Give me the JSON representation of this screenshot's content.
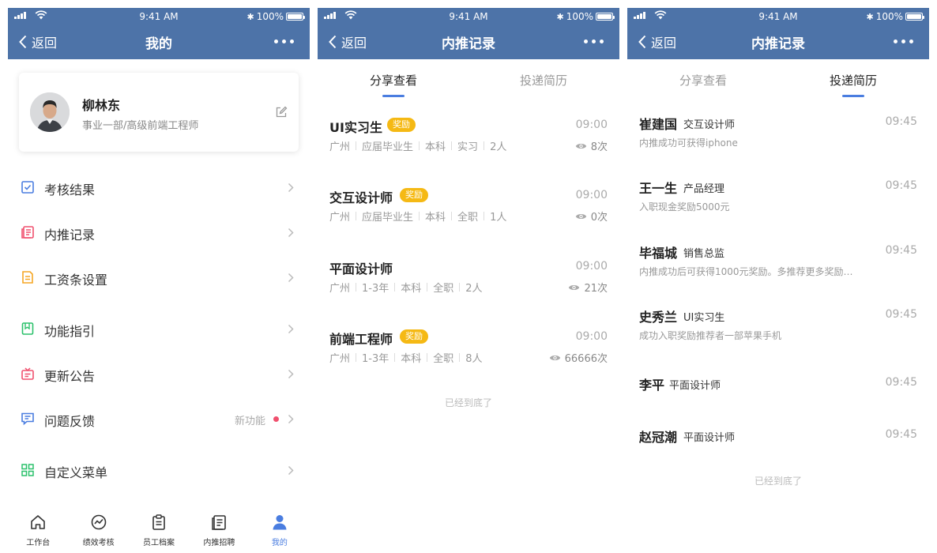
{
  "status": {
    "time": "9:41 AM",
    "battery": "100%"
  },
  "screens": {
    "mine": {
      "back_label": "返回",
      "title": "我的",
      "profile": {
        "name": "柳林东",
        "role": "事业一部/高级前端工程师"
      },
      "menu": [
        {
          "label": "考核结果",
          "icon": "checklist-icon",
          "color": "#4a7de0"
        },
        {
          "label": "内推记录",
          "icon": "record-icon",
          "color": "#f0506e"
        },
        {
          "label": "工资条设置",
          "icon": "payslip-icon",
          "color": "#f5a623"
        },
        {
          "label": "功能指引",
          "icon": "bookmark-icon",
          "color": "#2bc16b"
        },
        {
          "label": "更新公告",
          "icon": "announcement-icon",
          "color": "#f0506e"
        },
        {
          "label": "问题反馈",
          "icon": "feedback-icon",
          "color": "#4a7de0",
          "badge": "新功能"
        },
        {
          "label": "自定义菜单",
          "icon": "grid-icon",
          "color": "#2bc16b"
        }
      ],
      "tabbar": [
        {
          "label": "工作台",
          "icon": "home-icon"
        },
        {
          "label": "绩效考核",
          "icon": "performance-icon"
        },
        {
          "label": "员工档案",
          "icon": "clipboard-icon"
        },
        {
          "label": "内推招聘",
          "icon": "document-icon"
        },
        {
          "label": "我的",
          "icon": "user-icon",
          "active": true
        }
      ]
    },
    "share": {
      "back_label": "返回",
      "title": "内推记录",
      "tabs": [
        "分享查看",
        "投递简历"
      ],
      "jobs": [
        {
          "title": "UI实习生",
          "badge": "奖励",
          "time": "09:00",
          "tags": [
            "广州",
            "应届毕业生",
            "本科",
            "实习",
            "2人"
          ],
          "views": "8次"
        },
        {
          "title": "交互设计师",
          "badge": "奖励",
          "time": "09:00",
          "tags": [
            "广州",
            "应届毕业生",
            "本科",
            "全职",
            "1人"
          ],
          "views": "0次"
        },
        {
          "title": "平面设计师",
          "badge": "",
          "time": "09:00",
          "tags": [
            "广州",
            "1-3年",
            "本科",
            "全职",
            "2人"
          ],
          "views": "21次"
        },
        {
          "title": "前端工程师",
          "badge": "奖励",
          "time": "09:00",
          "tags": [
            "广州",
            "1-3年",
            "本科",
            "全职",
            "8人"
          ],
          "views": "66666次"
        }
      ],
      "end_note": "已经到底了"
    },
    "resumes": {
      "back_label": "返回",
      "title": "内推记录",
      "tabs": [
        "分享查看",
        "投递简历"
      ],
      "candidates": [
        {
          "name": "崔建国",
          "position": "交互设计师",
          "time": "09:45",
          "desc": "内推成功可获得iphone"
        },
        {
          "name": "王一生",
          "position": "产品经理",
          "time": "09:45",
          "desc": "入职现金奖励5000元"
        },
        {
          "name": "毕福城",
          "position": "销售总监",
          "time": "09:45",
          "desc": "内推成功后可获得1000元奖励。多推荐更多奖励…"
        },
        {
          "name": "史秀兰",
          "position": "UI实习生",
          "time": "09:45",
          "desc": "成功入职奖励推荐者一部苹果手机"
        },
        {
          "name": "李平",
          "position": "平面设计师",
          "time": "09:45",
          "desc": ""
        },
        {
          "name": "赵冠潮",
          "position": "平面设计师",
          "time": "09:45",
          "desc": ""
        }
      ],
      "end_note": "已经到底了"
    }
  },
  "colors": {
    "header": "#4d73a8",
    "accent": "#4a7de0",
    "badge": "#f5b914",
    "dot": "#f0506e"
  }
}
